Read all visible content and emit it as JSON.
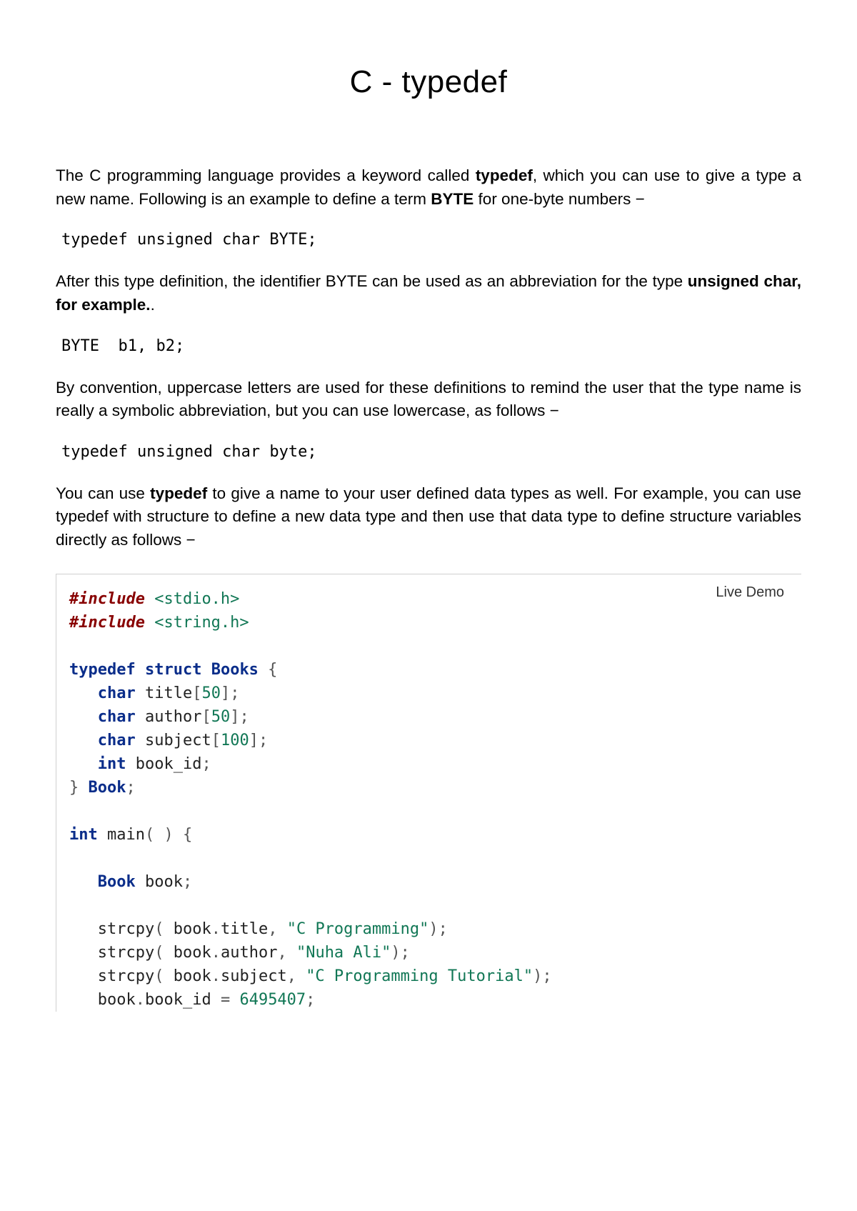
{
  "title": "C - typedef",
  "p1_a": "The C programming language provides a keyword called ",
  "p1_b": "typedef",
  "p1_c": ", which you can use to give a type a new name. Following is an example to define a term ",
  "p1_d": "BYTE",
  "p1_e": " for one-byte numbers −",
  "code1": "typedef unsigned char BYTE;",
  "p2_a": "After this type definition, the identifier BYTE can be used as an abbreviation for the type ",
  "p2_b": "unsigned char, for example.",
  "p2_c": ".",
  "code2": "BYTE  b1, b2;",
  "p3": "By convention, uppercase letters are used for these definitions to remind the user that the type name is really a symbolic abbreviation, but you can use lowercase, as follows −",
  "code3": "typedef unsigned char byte;",
  "p4_a": "You can use ",
  "p4_b": "typedef",
  "p4_c": " to give a name to your user defined data types as well. For example, you can use typedef with structure to define a new data type and then use that data type to define structure variables directly as follows −",
  "live_demo": "Live Demo",
  "code_tokens": {
    "include": "#include",
    "stdio": " <stdio.h>",
    "string": " <string.h>",
    "typedef": "typedef",
    "struct": "struct",
    "Books": "Books",
    "lbrace": " {",
    "char": "char",
    "title_field": " title",
    "arr50": "[",
    "n50": "50",
    "arr_close": "];",
    "author_field": " author",
    "subject_field": " subject",
    "n100": "100",
    "int": "int",
    "bookid_field": " book_id",
    "semi": ";",
    "rbrace": "} ",
    "Book": "Book",
    "main": " main",
    "parens": "( )",
    "book_decl": " book",
    "strcpy": "strcpy",
    "lp": "( ",
    "book_title": "book",
    "dot": ".",
    "title_m": "title",
    "comma_sp": ", ",
    "s1": "\"C Programming\"",
    "rp": ");",
    "author_m": "author",
    "s2": "\"Nuha Ali\"",
    "subject_m": "subject",
    "s3": "\"C Programming Tutorial\"",
    "assign_line_a": "book",
    "assign_line_b": "book_id ",
    "eq": "= ",
    "idnum": "6495407",
    "indent": "   "
  }
}
